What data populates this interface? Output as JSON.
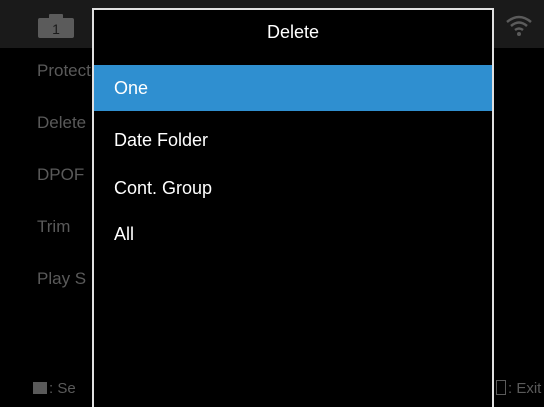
{
  "background": {
    "camera_badge": "1",
    "menu_items": [
      "Protect",
      "Delete",
      "DPOF",
      "Trim",
      "Play S"
    ],
    "bottom_left_hint": ": Se",
    "bottom_right_hint": ": Exit"
  },
  "dialog": {
    "title": "Delete",
    "options": [
      {
        "label": "One",
        "selected": true
      },
      {
        "label": "Date Folder",
        "selected": false
      },
      {
        "label": "Cont. Group",
        "selected": false
      },
      {
        "label": "All",
        "selected": false
      }
    ]
  },
  "colors": {
    "highlight": "#2f8fd0",
    "background": "#000000",
    "dim_text": "#5a5a5a"
  },
  "icons": [
    "camera-icon",
    "wifi-icon",
    "dpad-icon",
    "exit-icon"
  ]
}
